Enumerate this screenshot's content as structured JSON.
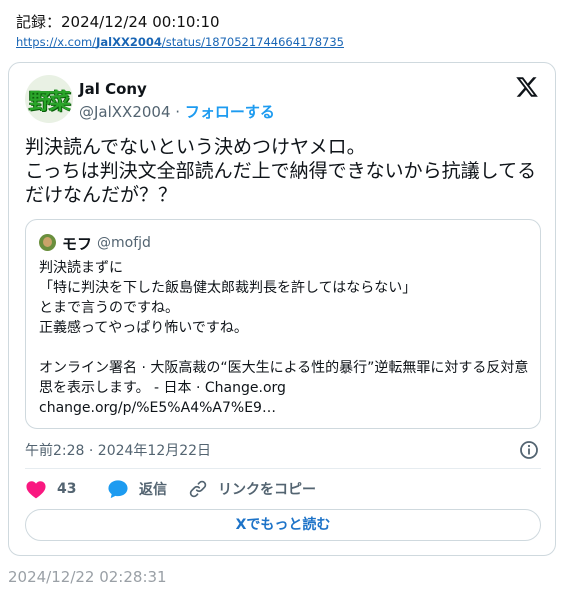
{
  "header": {
    "record": "記録：2024/12/24 00:10:10",
    "link_prefix": "https://x.com/",
    "link_user": "JalXX2004",
    "link_suffix": "/status/1870521744664178735"
  },
  "tweet": {
    "avatar_text": "野菜",
    "display_name": "Jal Cony",
    "handle": "@JalXX2004",
    "separator": "·",
    "follow_label": "フォローする",
    "text": "判決読んでないという決めつけヤメロ。\nこっちは判決文全部読んだ上で納得できないから抗議してるだけなんだが？？",
    "timestamp": "午前2:28 · 2024年12月22日"
  },
  "quote": {
    "display_name": "モフ",
    "handle": "@mofjd",
    "text": "判決読まずに\n「特に判決を下した飯島健太郎裁判長を許してはならない」\nとまで言うのですね。\n正義感ってやっぱり怖いですね。\n\nオンライン署名 · 大阪高裁の“医大生による性的暴行”逆転無罪に対する反対意思を表示します。 - 日本 · Change.org\nchange.org/p/%E5%A4%A7%E9…"
  },
  "actions": {
    "like_count": "43",
    "reply_label": "返信",
    "copy_link_label": "リンクをコピー"
  },
  "read_more_label": "Xでもっと読む",
  "footer_date": "2024/12/22 02:28:31",
  "colors": {
    "like": "#f91880",
    "reply": "#1d9bf0",
    "link": "#1a66b5",
    "follow": "#1d9bf0"
  }
}
